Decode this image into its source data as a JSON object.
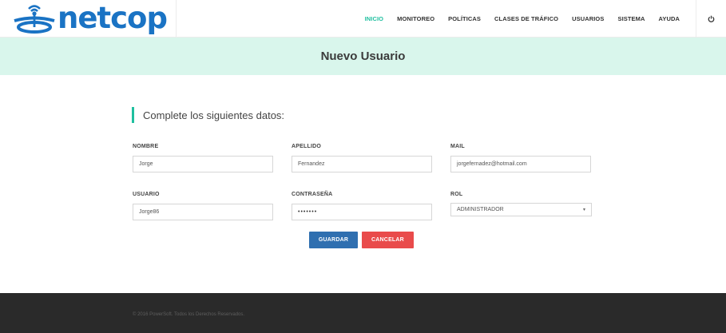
{
  "brand": {
    "name": "netcop"
  },
  "nav": {
    "items": [
      {
        "label": "INICIO",
        "active": true
      },
      {
        "label": "MONITOREO",
        "active": false
      },
      {
        "label": "POLÍTICAS",
        "active": false
      },
      {
        "label": "CLASES DE TRÁFICO",
        "active": false
      },
      {
        "label": "USUARIOS",
        "active": false
      },
      {
        "label": "SISTEMA",
        "active": false
      },
      {
        "label": "AYUDA",
        "active": false
      }
    ],
    "power_icon": "power-icon"
  },
  "page": {
    "title": "Nuevo Usuario"
  },
  "form": {
    "heading": "Complete los siguientes datos:",
    "nombre": {
      "label": "NOMBRE",
      "value": "Jorge"
    },
    "apellido": {
      "label": "APELLIDO",
      "value": "Fernandez"
    },
    "mail": {
      "label": "MAIL",
      "value": "jorgefernadez@hotmail.com"
    },
    "usuario": {
      "label": "USUARIO",
      "value": "Jorge86"
    },
    "contrasena": {
      "label": "CONTRASEÑA",
      "value": "•••••••"
    },
    "rol": {
      "label": "ROL",
      "value": "ADMINISTRADOR"
    },
    "save_label": "GUARDAR",
    "cancel_label": "CANCELAR"
  },
  "footer": {
    "text": "© 2016 PowerSoft. Todos los Derechos Reservados."
  },
  "colors": {
    "accent": "#1fbf9f",
    "brand": "#1a73c4",
    "band": "#d9f6ec",
    "save": "#2f6fb0",
    "cancel": "#e94b4b",
    "footer": "#2a2a2a"
  }
}
